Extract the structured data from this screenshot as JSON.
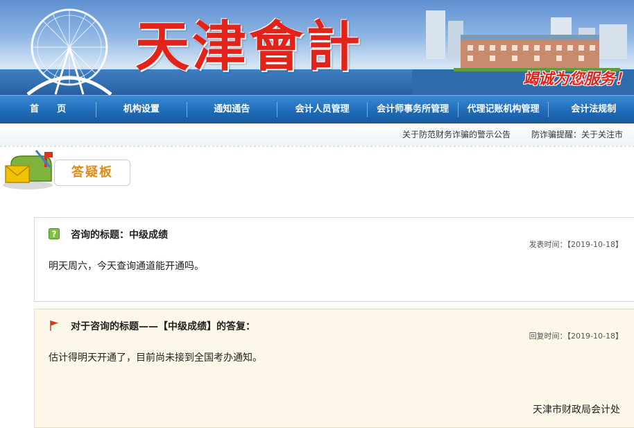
{
  "banner": {
    "logo_text": "天津會計",
    "slogan": "竭诚为您服务！"
  },
  "nav": {
    "items": [
      {
        "label": "首　　页"
      },
      {
        "label": "机构设置"
      },
      {
        "label": "通知通告"
      },
      {
        "label": "会计人员管理"
      },
      {
        "label": "会计师事务所管理"
      },
      {
        "label": "代理记账机构管理"
      },
      {
        "label": "会计法规制"
      }
    ]
  },
  "ticker": {
    "items": [
      "关于防范财务诈骗的警示公告",
      "防诈骗提醒：关于关注市"
    ]
  },
  "board": {
    "title": "答疑板"
  },
  "question": {
    "title": "咨询的标题：中级成绩",
    "time": "发表时间：【2019-10-18】",
    "body": "明天周六，今天查询通道能开通吗。"
  },
  "answer": {
    "title": "对于咨询的标题——【中级成绩】的答复：",
    "time": "回复时间：【2019-10-18】",
    "body": "估计得明天开通了，目前尚未接到全国考办通知。",
    "signature": "天津市财政局会计处"
  },
  "icons": {
    "question": "question-mark-icon",
    "answer": "red-flag-icon",
    "mailbox": "mailbox-icon"
  }
}
